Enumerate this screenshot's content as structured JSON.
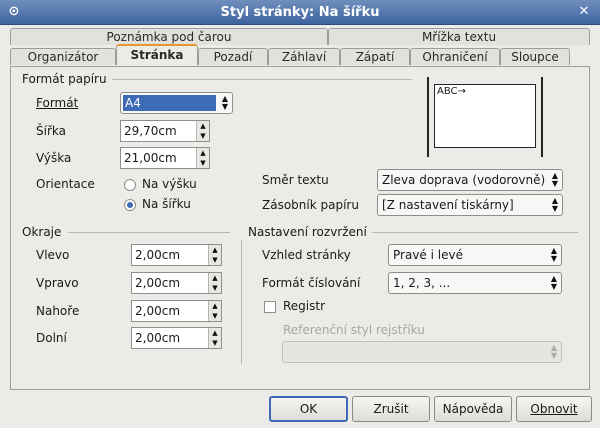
{
  "window": {
    "title": "Styl stránky: Na šířku",
    "menu_icon": "⊙",
    "close_icon": "✕"
  },
  "tabs": {
    "row_top": [
      "Poznámka pod čarou",
      "Mřížka textu"
    ],
    "row_bottom": [
      "Organizátor",
      "Stránka",
      "Pozadí",
      "Záhlaví",
      "Zápatí",
      "Ohraničení",
      "Sloupce"
    ],
    "active": "Stránka"
  },
  "paper": {
    "section": "Formát papíru",
    "format_label": "Formát",
    "format_value": "A4",
    "width_label": "Šířka",
    "width_value": "29,70cm",
    "height_label": "Výška",
    "height_value": "21,00cm",
    "orientation_label": "Orientace",
    "portrait": "Na výšku",
    "landscape": "Na šířku",
    "orientation_selected": "landscape",
    "text_direction_label": "Směr textu",
    "text_direction_value": "Zleva doprava (vodorovně)",
    "paper_tray_label": "Zásobník papíru",
    "paper_tray_value": "[Z nastavení tiskárny]"
  },
  "preview": {
    "text": "ABC→"
  },
  "margins": {
    "section": "Okraje",
    "left_label": "Vlevo",
    "left_value": "2,00cm",
    "right_label": "Vpravo",
    "right_value": "2,00cm",
    "top_label": "Nahoře",
    "top_value": "2,00cm",
    "bottom_label": "Dolní",
    "bottom_value": "2,00cm"
  },
  "layout": {
    "section": "Nastavení rozvržení",
    "page_layout_label": "Vzhled stránky",
    "page_layout_value": "Pravé i levé",
    "numbering_label": "Formát číslování",
    "numbering_value": "1, 2, 3, ...",
    "register_label": "Registr",
    "register_checked": false,
    "ref_style_label": "Referenční styl rejstříku",
    "ref_style_value": ""
  },
  "buttons": {
    "ok": "OK",
    "cancel": "Zrušit",
    "help": "Nápověda",
    "reset": "Obnovit"
  },
  "colors": {
    "accent": "#3d6bb5",
    "active_tab": "#e39a2c",
    "titlebar": "#3f63a0"
  }
}
